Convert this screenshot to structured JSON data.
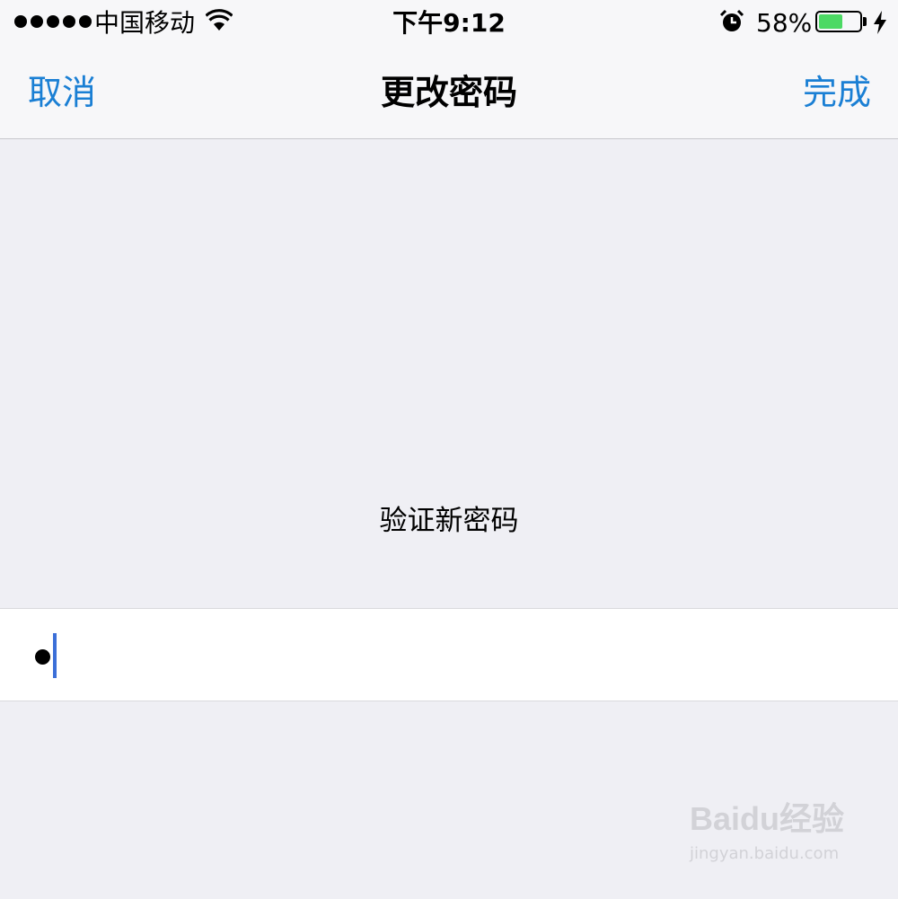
{
  "status_bar": {
    "carrier": "中国移动",
    "time": "下午9:12",
    "battery_percent_text": "58%",
    "battery_level": 0.58,
    "battery_color": "#4cd964",
    "icons": [
      "signal-dots",
      "wifi-icon",
      "alarm-icon",
      "battery-icon",
      "charging-icon"
    ]
  },
  "nav": {
    "cancel_label": "取消",
    "title": "更改密码",
    "done_label": "完成",
    "accent_color": "#1a7fd4"
  },
  "content": {
    "prompt": "验证新密码",
    "password_field": {
      "masked_char_count": 1,
      "focused": true
    }
  },
  "watermark": {
    "brand": "Baidu经验",
    "url": "jingyan.baidu.com"
  }
}
